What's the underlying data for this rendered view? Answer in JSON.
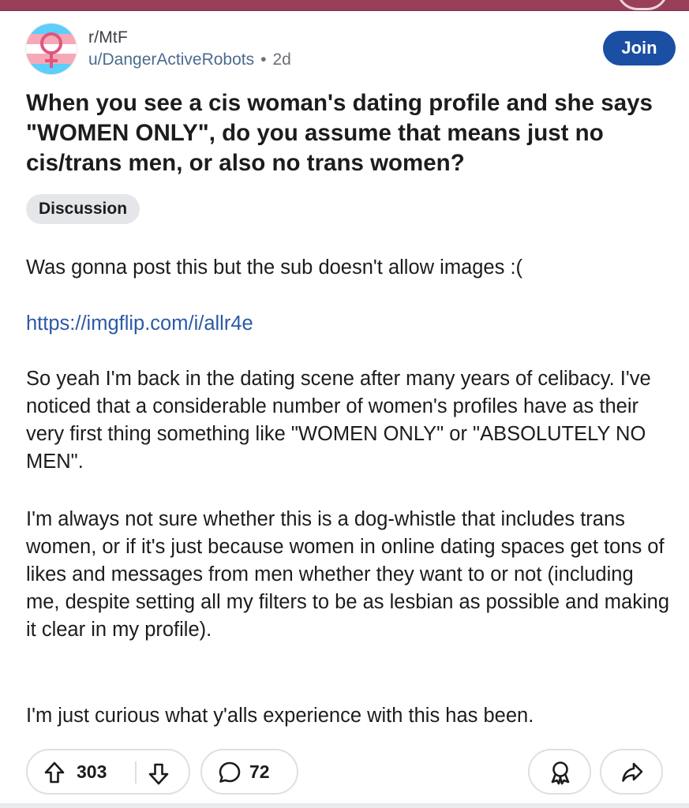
{
  "header": {
    "subreddit": "r/MtF",
    "username": "u/DangerActiveRobots",
    "separator": "•",
    "time": "2d",
    "join_label": "Join",
    "avatar_icon": "trans-flag-venus-icon",
    "colors": {
      "flag_blue": "#5bcefa",
      "flag_pink": "#f5a9b8",
      "join_bg": "#1a4fa3",
      "top_bar": "#9a3f5a"
    }
  },
  "post": {
    "title": "When you see a cis woman's dating profile and she says \"WOMEN ONLY\", do you assume that means just no cis/trans men, or also no trans women?",
    "flair": "Discussion",
    "paragraph1": "Was gonna post this but the sub doesn't allow images :(",
    "link": "https://imgflip.com/i/allr4e",
    "paragraph2": "So yeah I'm back in the dating scene after many years of celibacy. I've noticed that a considerable number of women's profiles have as their very first thing something like \"WOMEN ONLY\" or \"ABSOLUTELY NO MEN\".",
    "paragraph3": "I'm always not sure whether this is a dog-whistle that includes trans women, or if it's just because women in online dating spaces get tons of likes and messages from men whether they want to or not (including me, despite setting all my filters to be as lesbian as possible and making it clear in my profile).",
    "paragraph4": "I'm just curious what y'alls experience with this has been."
  },
  "actions": {
    "upvotes": "303",
    "comments": "72",
    "icons": [
      "upvote-arrow-icon",
      "downvote-arrow-icon",
      "comment-bubble-icon",
      "award-icon",
      "share-arrow-icon"
    ]
  }
}
